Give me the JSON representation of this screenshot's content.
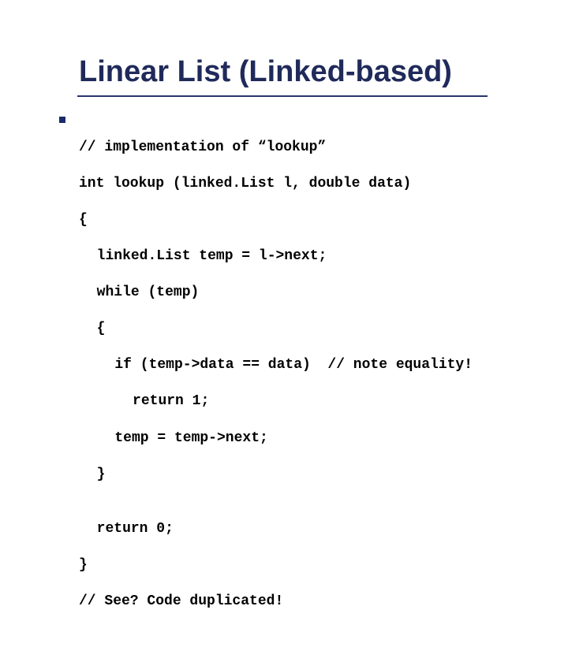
{
  "title": "Linear List (Linked-based)",
  "code": {
    "l1": "// implementation of “lookup”",
    "l2a": "int lookup (linked.List l, ",
    "l2b": "double",
    "l2c": " data)",
    "l3": "{",
    "l4": "linked.List temp = l->next;",
    "l5": "while (temp)",
    "l6": "{",
    "l7": "if (temp->data == data)  // note equality!",
    "l8": "return 1;",
    "l9": "temp = temp->next;",
    "l10": "}",
    "l11": "",
    "l12": "return 0;",
    "l13": "}",
    "l14": "// See? Code duplicated!"
  }
}
